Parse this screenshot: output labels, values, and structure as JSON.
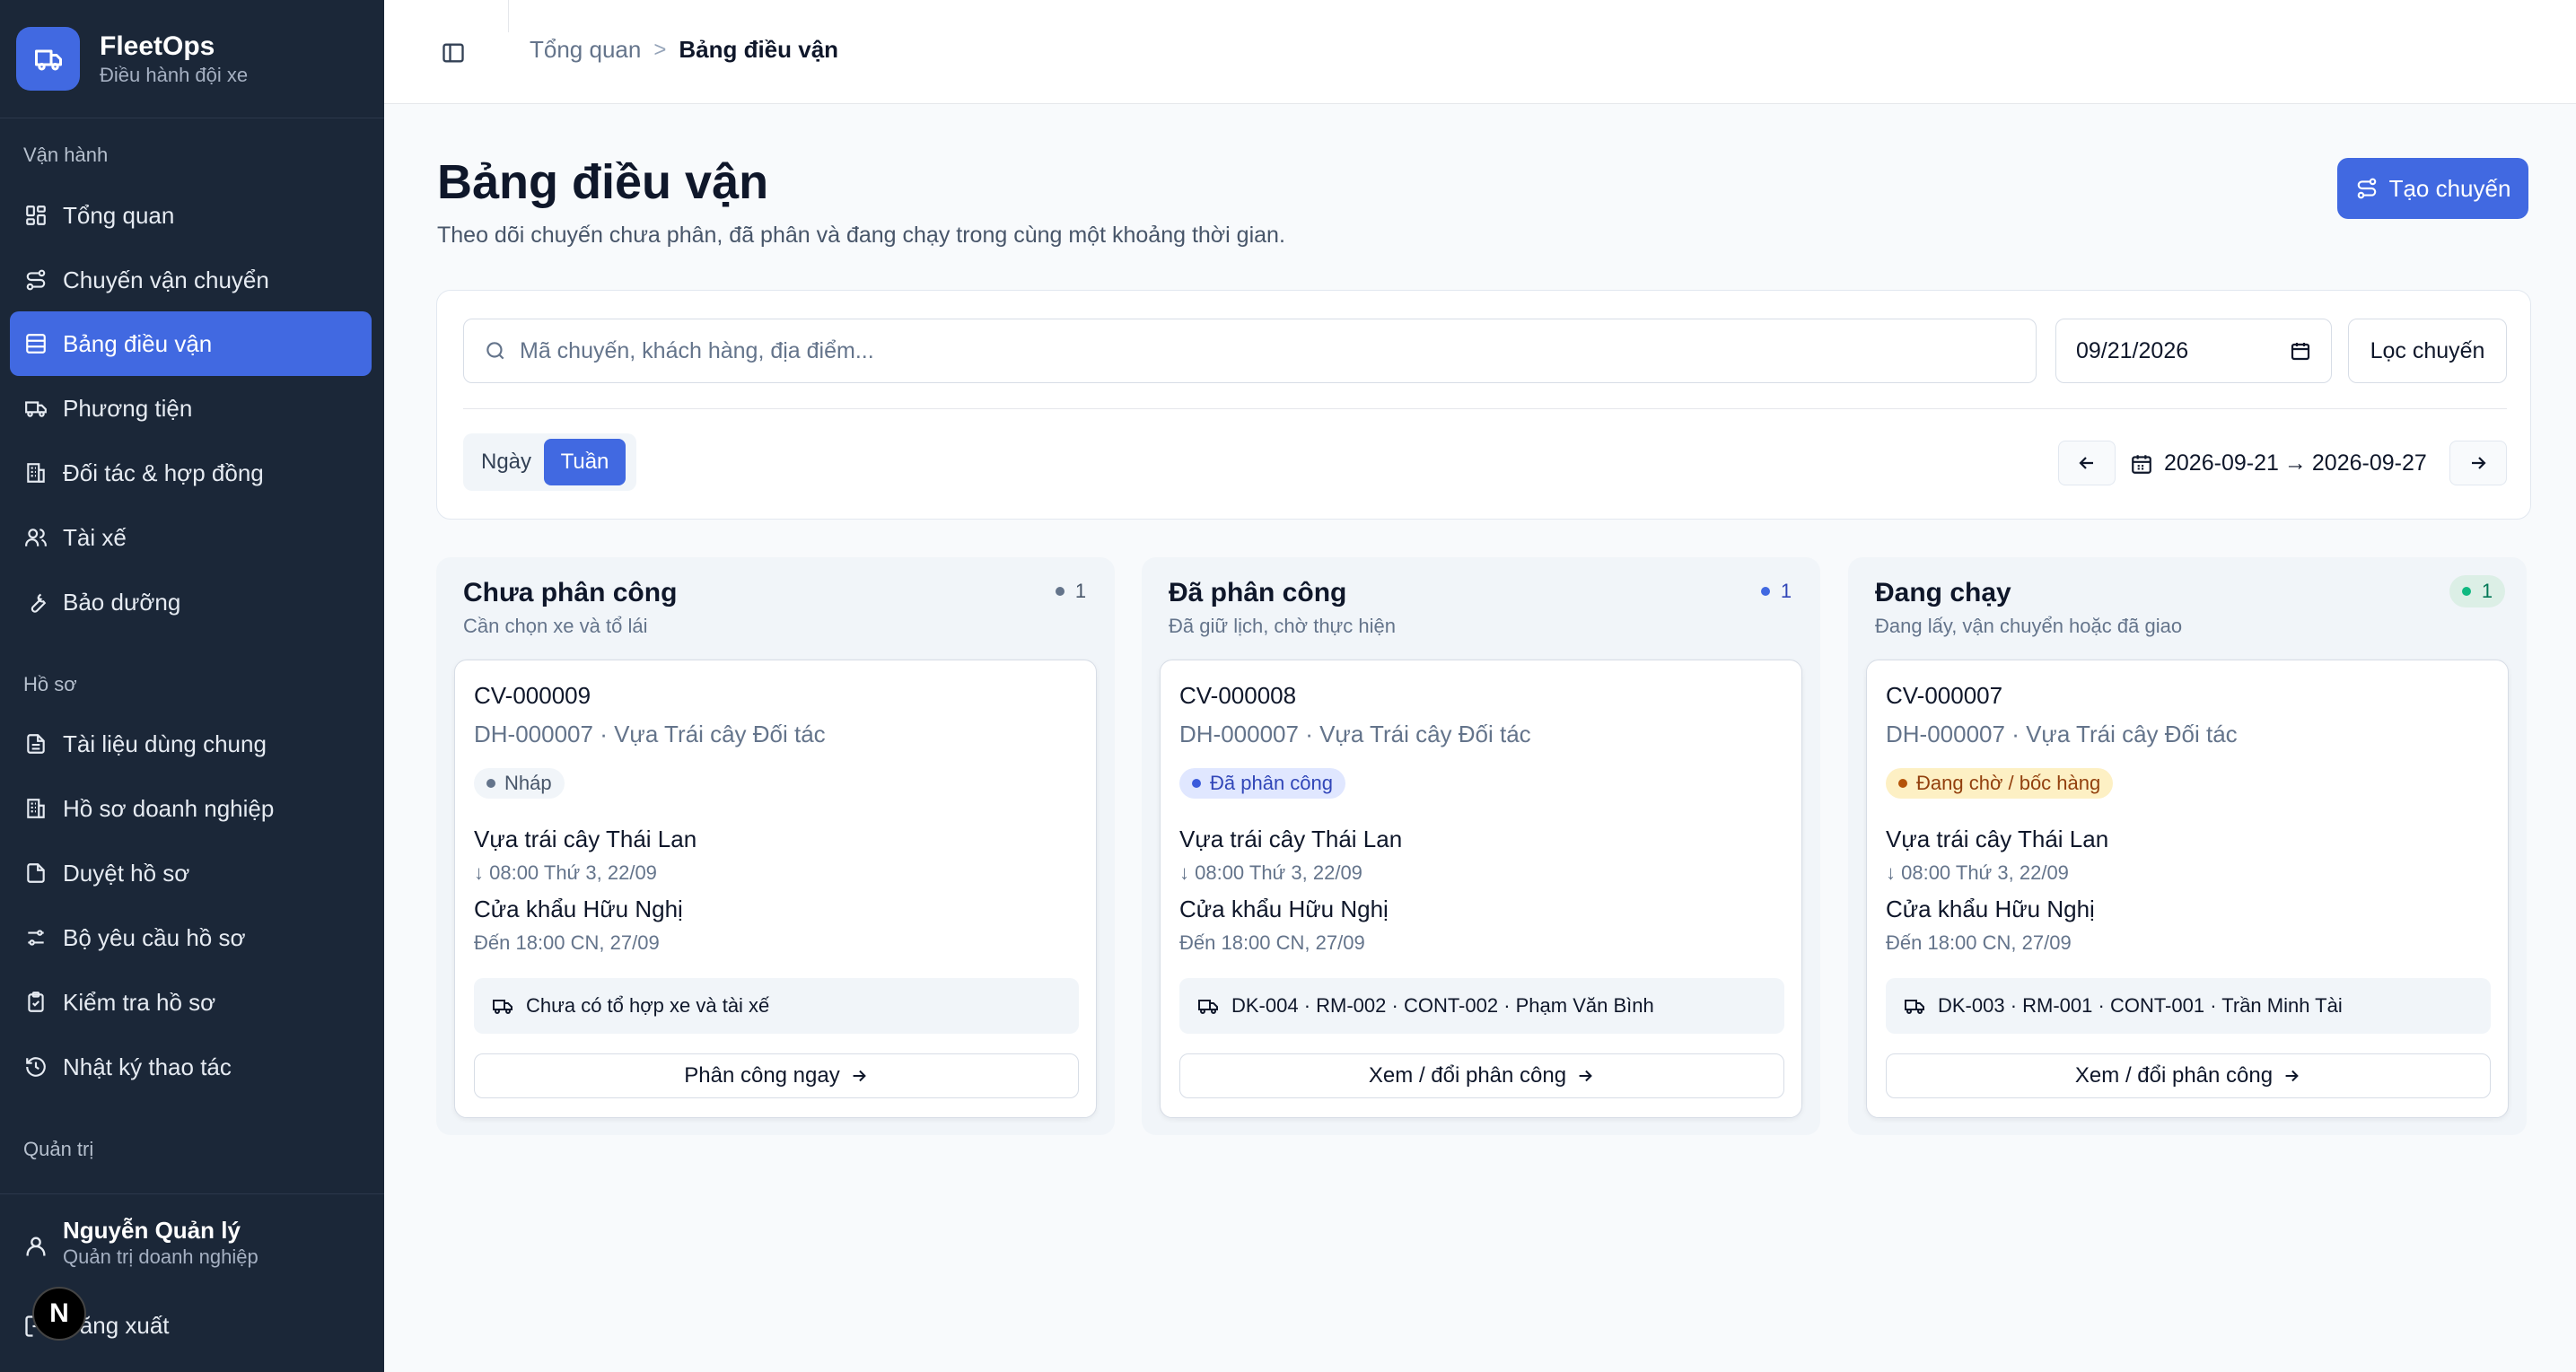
{
  "app": {
    "name": "FleetOps",
    "tagline": "Điều hành đội xe"
  },
  "sidebar": {
    "sections": [
      {
        "label": "Vận hành"
      },
      {
        "label": "Hồ sơ"
      },
      {
        "label": "Quản trị"
      }
    ],
    "items": [
      {
        "label": "Tổng quan",
        "icon": "grid-icon"
      },
      {
        "label": "Chuyến vận chuyển",
        "icon": "route-icon"
      },
      {
        "label": "Bảng điều vận",
        "icon": "table-icon",
        "active": true
      },
      {
        "label": "Phương tiện",
        "icon": "truck-icon"
      },
      {
        "label": "Đối tác & hợp đồng",
        "icon": "building-icon"
      },
      {
        "label": "Tài xế",
        "icon": "users-icon"
      },
      {
        "label": "Bảo dưỡng",
        "icon": "wrench-icon"
      },
      {
        "label": "Tài liệu dùng chung",
        "icon": "file-text-icon"
      },
      {
        "label": "Hồ sơ doanh nghiệp",
        "icon": "building-icon"
      },
      {
        "label": "Duyệt hồ sơ",
        "icon": "file-check-icon"
      },
      {
        "label": "Bộ yêu cầu hồ sơ",
        "icon": "sliders-icon"
      },
      {
        "label": "Kiểm tra hồ sơ",
        "icon": "clipboard-check-icon"
      },
      {
        "label": "Nhật ký thao tác",
        "icon": "history-icon"
      }
    ],
    "user": {
      "name": "Nguyễn Quản lý",
      "role": "Quản trị doanh nghiệp"
    },
    "logout": "Đăng xuất",
    "dev_badge": "N"
  },
  "breadcrumb": {
    "parent": "Tổng quan",
    "separator": ">",
    "current": "Bảng điều vận"
  },
  "page": {
    "title": "Bảng điều vận",
    "description": "Theo dõi chuyến chưa phân, đã phân và đang chạy trong cùng một khoảng thời gian.",
    "create_button": "Tạo chuyến"
  },
  "filters": {
    "search_placeholder": "Mã chuyến, khách hàng, địa điểm...",
    "search_value": "",
    "date_value": "09/21/2026",
    "filter_button": "Lọc chuyến",
    "view_day": "Ngày",
    "view_week": "Tuần",
    "selected_view": "Tuần",
    "range_start": "2026-09-21",
    "range_arrow": "→",
    "range_end": "2026-09-27"
  },
  "columns": [
    {
      "title": "Chưa phân công",
      "subtitle": "Cần chọn xe và tổ lái",
      "count": "1",
      "dot_color": "#64748b",
      "count_bg": "transparent",
      "card": {
        "code": "CV-000009",
        "order": "DH-000007 · Vựa Trái cây Đối tác",
        "status": "Nháp",
        "status_bg": "#f1f5f9",
        "status_fg": "#475569",
        "status_dot": "#64748b",
        "pickup": "Vựa trái cây Thái Lan",
        "pickup_time": "↓ 08:00 Thứ 3, 22/09",
        "dropoff": "Cửa khẩu Hữu Nghị",
        "dropoff_time": "Đến 18:00 CN, 27/09",
        "assignment": "Chưa có tổ hợp xe và tài xế",
        "action": "Phân công ngay"
      }
    },
    {
      "title": "Đã phân công",
      "subtitle": "Đã giữ lịch, chờ thực hiện",
      "count": "1",
      "dot_color": "#4169e1",
      "count_bg": "transparent",
      "card": {
        "code": "CV-000008",
        "order": "DH-000007 · Vựa Trái cây Đối tác",
        "status": "Đã phân công",
        "status_bg": "#e0e7ff",
        "status_fg": "#3146b8",
        "status_dot": "#3b5bdb",
        "pickup": "Vựa trái cây Thái Lan",
        "pickup_time": "↓ 08:00 Thứ 3, 22/09",
        "dropoff": "Cửa khẩu Hữu Nghị",
        "dropoff_time": "Đến 18:00 CN, 27/09",
        "assignment": "DK-004 · RM-002 · CONT-002 · Phạm Văn Bình",
        "action": "Xem / đổi phân công"
      }
    },
    {
      "title": "Đang chạy",
      "subtitle": "Đang lấy, vận chuyển hoặc đã giao",
      "count": "1",
      "dot_color": "#10b981",
      "count_bg": "#dcefe6",
      "card": {
        "code": "CV-000007",
        "order": "DH-000007 · Vựa Trái cây Đối tác",
        "status": "Đang chờ / bốc hàng",
        "status_bg": "#fdf0c4",
        "status_fg": "#92400e",
        "status_dot": "#b45309",
        "pickup": "Vựa trái cây Thái Lan",
        "pickup_time": "↓ 08:00 Thứ 3, 22/09",
        "dropoff": "Cửa khẩu Hữu Nghị",
        "dropoff_time": "Đến 18:00 CN, 27/09",
        "assignment": "DK-003 · RM-001 · CONT-001 · Trần Minh Tài",
        "action": "Xem / đổi phân công"
      }
    }
  ],
  "colors": {
    "accent": "#4169e1",
    "sidebar_bg": "#1b2738"
  }
}
